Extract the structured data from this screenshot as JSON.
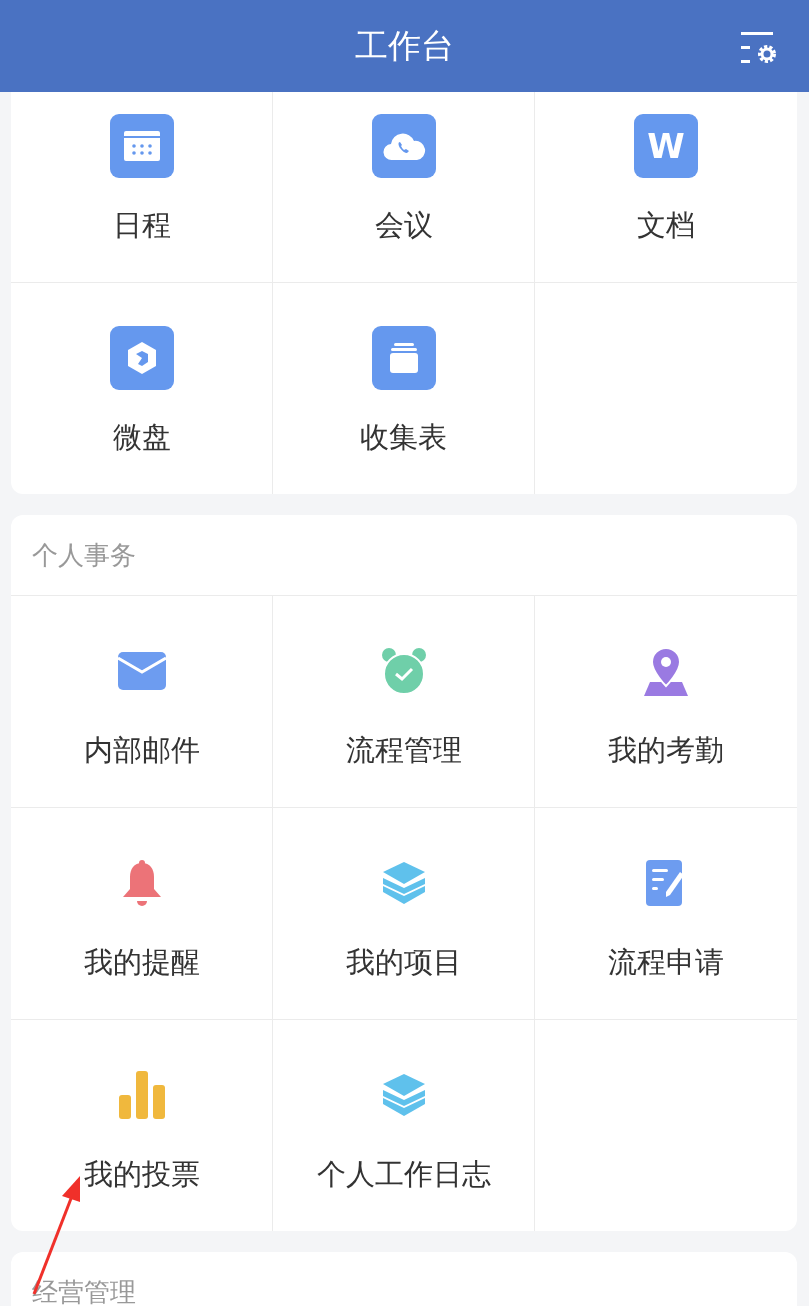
{
  "header": {
    "title": "工作台"
  },
  "sections": [
    {
      "items": [
        {
          "label": "日程",
          "kind": "calendar"
        },
        {
          "label": "会议",
          "kind": "cloud"
        },
        {
          "label": "文档",
          "kind": "word",
          "icon_text": "W"
        },
        {
          "label": "微盘",
          "kind": "drive"
        },
        {
          "label": "收集表",
          "kind": "stack"
        }
      ]
    },
    {
      "title": "个人事务",
      "items": [
        {
          "label": "内部邮件",
          "kind": "mail"
        },
        {
          "label": "流程管理",
          "kind": "alarm"
        },
        {
          "label": "我的考勤",
          "kind": "location"
        },
        {
          "label": "我的提醒",
          "kind": "bell"
        },
        {
          "label": "我的项目",
          "kind": "layers"
        },
        {
          "label": "流程申请",
          "kind": "form"
        },
        {
          "label": "我的投票",
          "kind": "bars"
        },
        {
          "label": "个人工作日志",
          "kind": "layers"
        }
      ]
    },
    {
      "title": "经营管理"
    }
  ]
}
